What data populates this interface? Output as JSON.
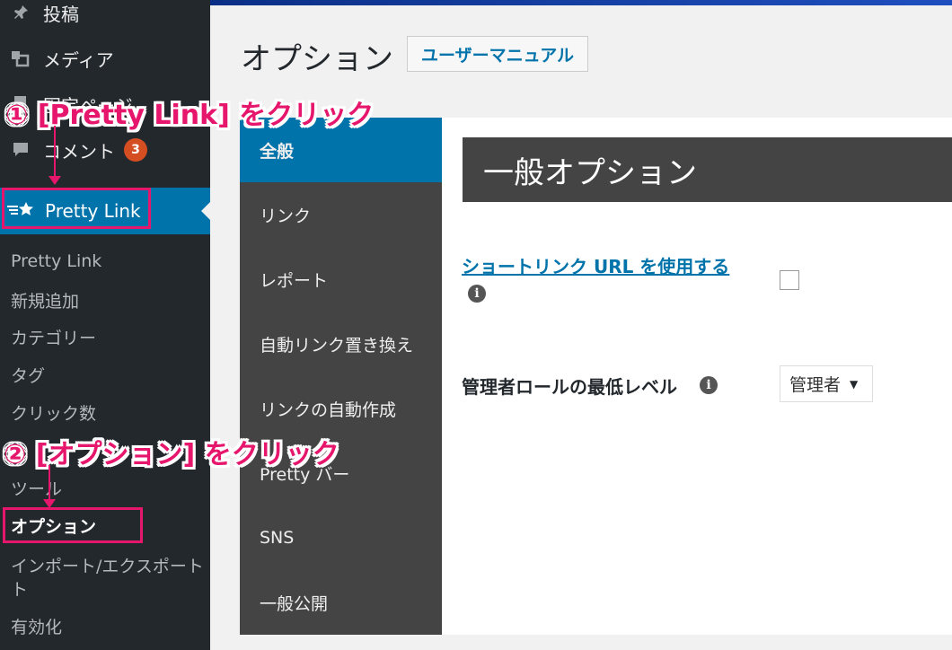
{
  "sidebar": {
    "items": [
      {
        "label": "投稿",
        "icon": "pin-icon"
      },
      {
        "label": "メディア",
        "icon": "media-icon"
      },
      {
        "label": "固定ページ",
        "icon": "page-icon"
      },
      {
        "label": "コメント",
        "icon": "comment-icon",
        "badge": "3"
      }
    ],
    "active": {
      "label": "Pretty Link",
      "icon": "star-icon"
    },
    "submenu": [
      "Pretty Link",
      "新規追加",
      "カテゴリー",
      "タグ",
      "クリック数",
      "ツール",
      "オプション",
      "インポート/エクスポート",
      "ト",
      "有効化"
    ],
    "submenu_current": "オプション"
  },
  "header": {
    "title": "オプション",
    "manual_button": "ユーザーマニュアル"
  },
  "options_nav": {
    "tabs": [
      "全般",
      "リンク",
      "レポート",
      "自動リンク置き換え",
      "リンクの自動作成",
      "Pretty バー",
      "SNS",
      "一般公開"
    ],
    "active_tab": "全般"
  },
  "panel": {
    "section_title": "一般オプション",
    "shortlink_label": "ショートリンク URL を使用する",
    "shortlink_checked": false,
    "role_label": "管理者ロールの最低レベル",
    "role_value": "管理者",
    "info_glyph": "i"
  },
  "annotations": {
    "step1": "① [Pretty Link] をクリック",
    "step2": "② [オプション] をクリック",
    "color": "#e5166b"
  },
  "colors": {
    "sidebar_bg": "#23282d",
    "accent": "#0073aa",
    "nav_bg": "#444444",
    "badge": "#d54e21"
  }
}
